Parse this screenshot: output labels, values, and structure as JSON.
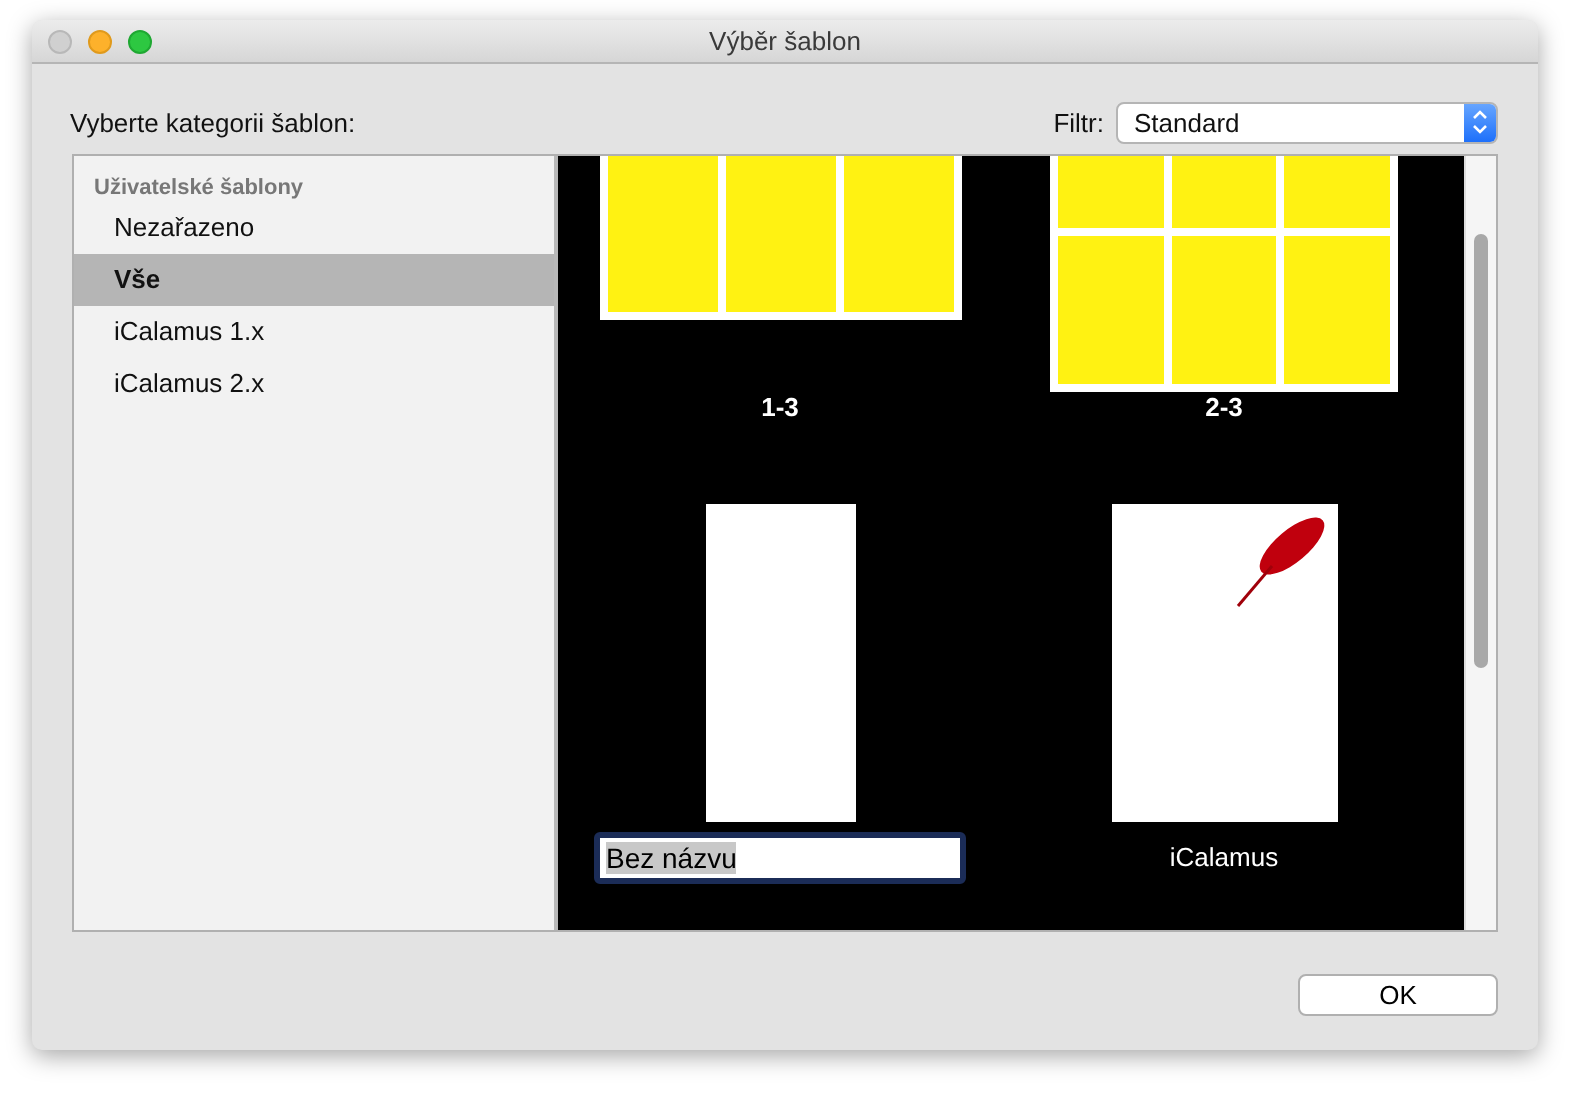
{
  "window": {
    "title": "Výběr šablon"
  },
  "category_label": "Vyberte kategorii šablon:",
  "filter": {
    "label": "Filtr:",
    "value": "Standard"
  },
  "sidebar": {
    "header": "Uživatelské šablony",
    "items": [
      {
        "label": "Nezařazeno",
        "selected": false
      },
      {
        "label": "Vše",
        "selected": true
      },
      {
        "label": "iCalamus 1.x",
        "selected": false
      },
      {
        "label": "iCalamus 2.x",
        "selected": false
      }
    ]
  },
  "templates": [
    {
      "kind": "columns",
      "name": "1-3",
      "editing": false
    },
    {
      "kind": "grid",
      "name": "2-3",
      "editing": false
    },
    {
      "kind": "blank",
      "name": "Bez názvu",
      "editing": true
    },
    {
      "kind": "logo",
      "name": "iCalamus",
      "editing": false
    }
  ],
  "buttons": [
    "OK"
  ]
}
